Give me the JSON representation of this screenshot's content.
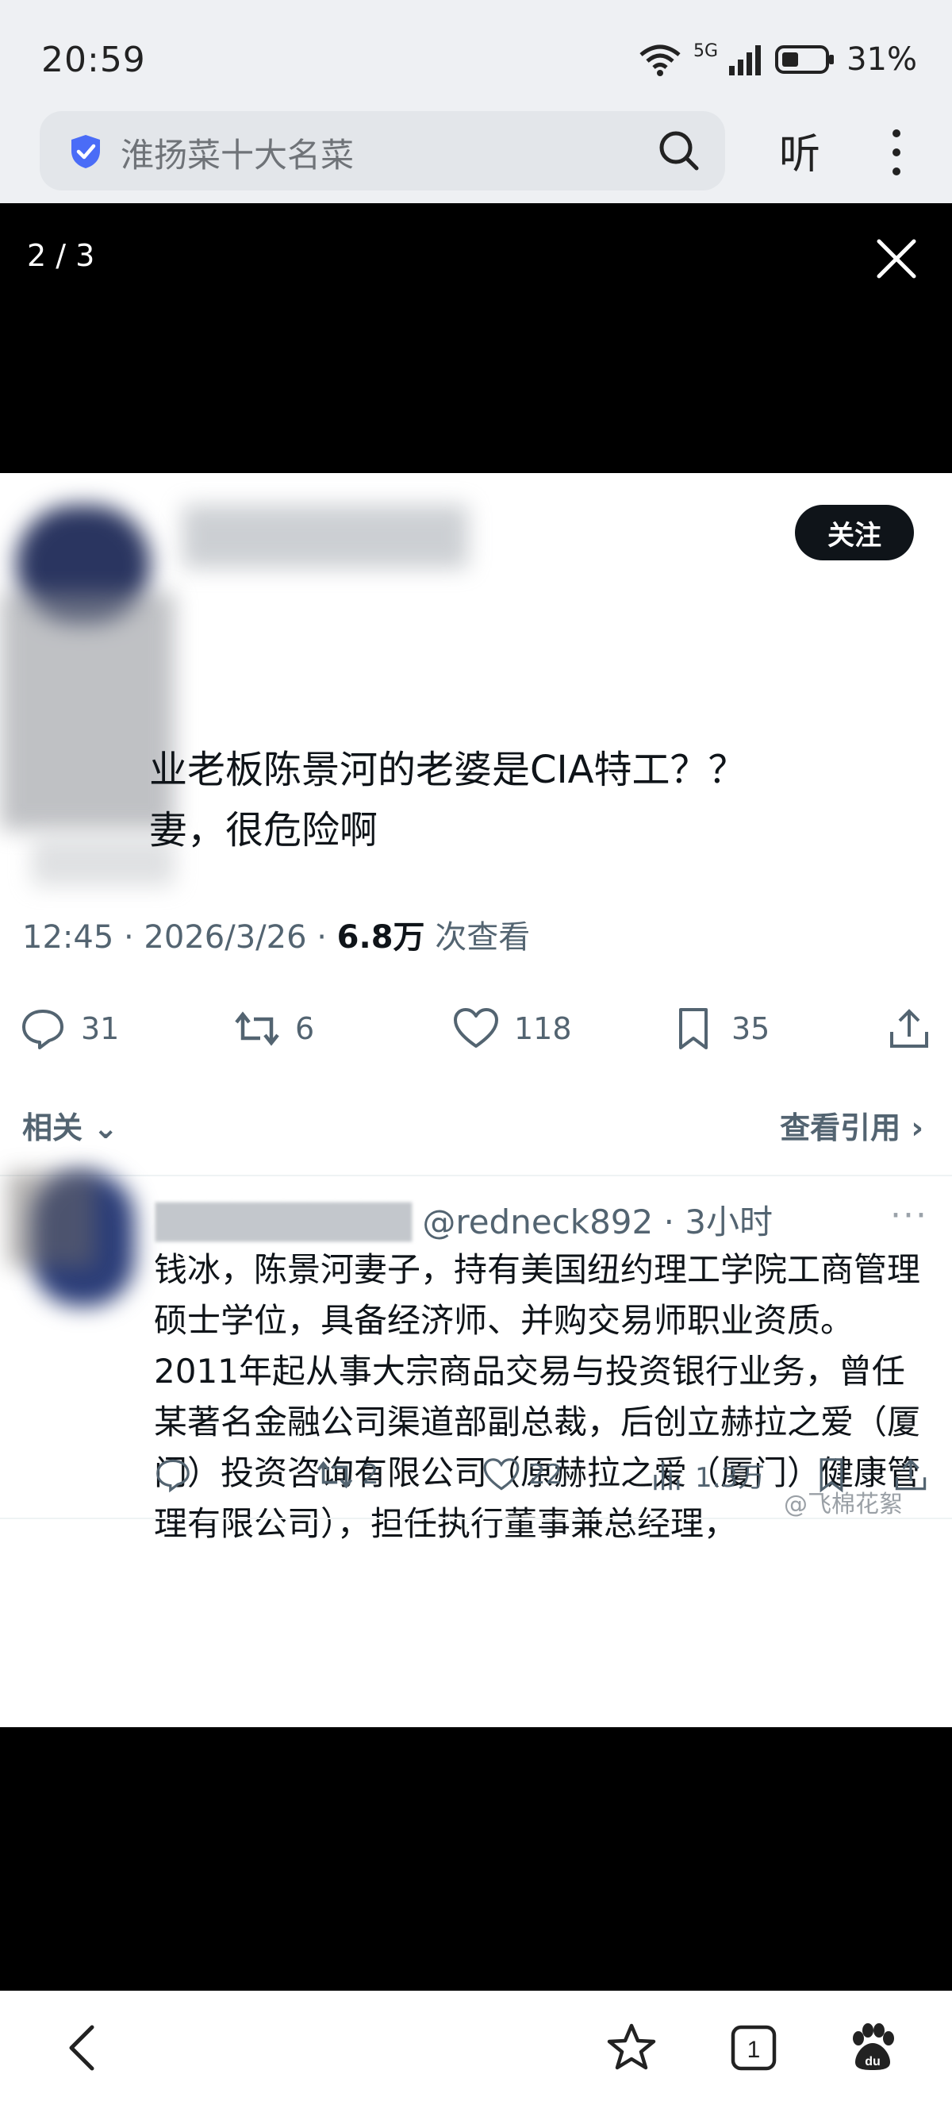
{
  "status": {
    "time": "20:59",
    "network": "5G",
    "battery": "31%"
  },
  "browser": {
    "search_query": "淮扬菜十大名菜",
    "listen_label": "听"
  },
  "viewer": {
    "counter": "2 / 3"
  },
  "tweet": {
    "follow_label": "关注",
    "line1": "业老板陈景河的老婆是CIA特工？？",
    "line2": "妻，很危险啊",
    "meta_time": "12:45 · 2026/3/26 · ",
    "meta_views": "6.8万",
    "meta_views_label": " 次查看",
    "replies": "31",
    "retweets": "6",
    "likes": "118",
    "bookmarks": "35"
  },
  "related": {
    "label": "相关",
    "view_quotes": "查看引用"
  },
  "reply": {
    "handle": "@redneck892 · 3小时",
    "text": "钱冰，陈景河妻子，持有美国纽约理工学院工商管理硕士学位，具备经济师、并购交易师职业资质。2011年起从事大宗商品交易与投资银行业务，曾任某著名金融公司渠道部副总裁，后创立赫拉之爱（厦门）投资咨询有限公司（原赫拉之爱（厦门）健康管理有限公司），担任执行董事兼总经理，",
    "retweets": "2",
    "likes": "22",
    "views": "1.3万"
  },
  "watermark": "@飞棉花絮",
  "colors": {
    "accent": "#0f1419",
    "muted": "#536471",
    "shield": "#4a6cf7"
  }
}
